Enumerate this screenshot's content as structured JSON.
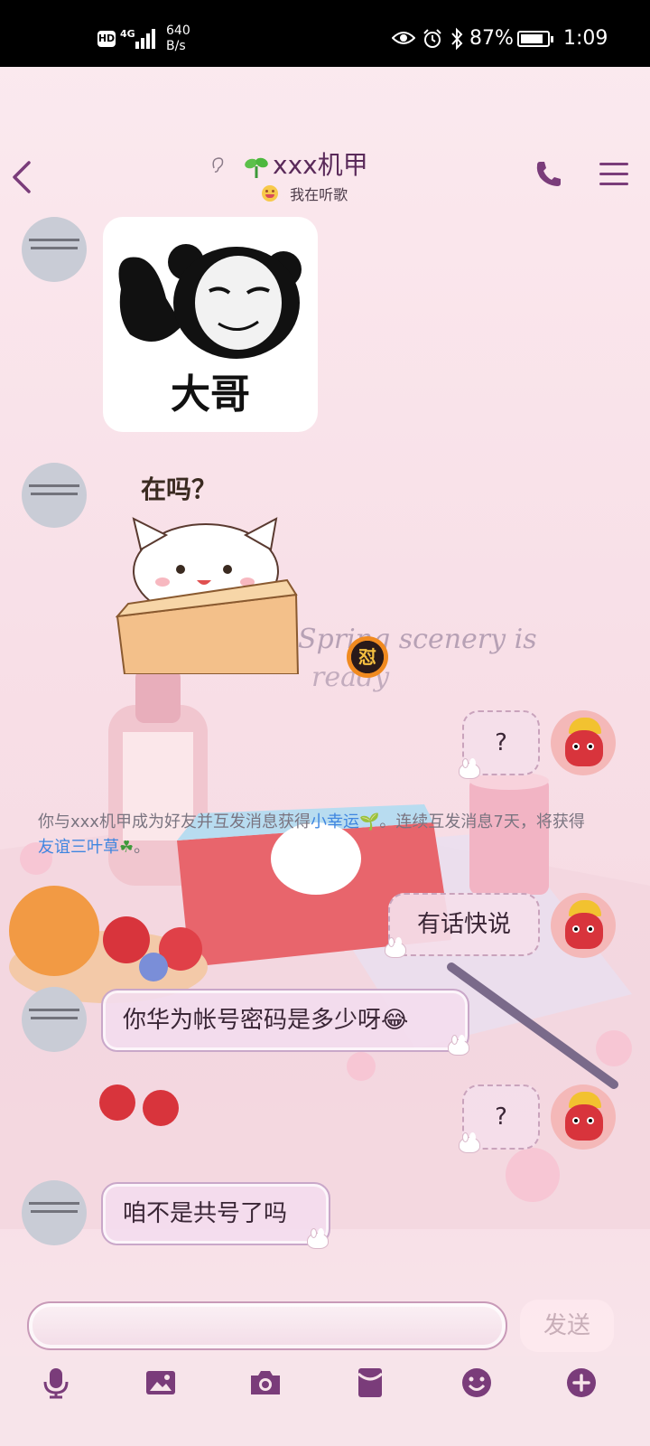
{
  "status_bar": {
    "hd": "HD",
    "network": "4G",
    "speed_value": "640",
    "speed_unit": "B/s",
    "battery_pct": "87%",
    "battery_level": 0.87,
    "time": "1:09"
  },
  "header": {
    "title": "xxx机甲",
    "subtitle": "我在听歌"
  },
  "messages": [
    {
      "side": "left",
      "type": "sticker",
      "sticker": "panda-meme",
      "caption": "大哥"
    },
    {
      "side": "left",
      "type": "sticker",
      "sticker": "cat-in-box",
      "caption": "在吗？"
    },
    {
      "side": "right",
      "type": "text",
      "text": "?"
    },
    {
      "side": "system",
      "type": "notice"
    },
    {
      "side": "right",
      "type": "text",
      "text": "有话快说"
    },
    {
      "side": "left",
      "type": "text",
      "text": "你华为帐号密码是多少呀😂"
    },
    {
      "side": "right",
      "type": "text",
      "text": "?"
    },
    {
      "side": "left",
      "type": "text",
      "text": "咱不是共号了吗"
    }
  ],
  "system_notice": {
    "part1": "你与xxx机甲成为好友并互发消息获得",
    "link1": "小幸运",
    "part2": "。连续互发消息7天，将获得",
    "link2": "友谊三叶草",
    "part3": "。"
  },
  "fire_badge": "怼",
  "background_text": {
    "line1": "Spring scenery is",
    "line2": "ready"
  },
  "input": {
    "value": "",
    "send_label": "发送"
  },
  "toolbar_icons": [
    "microphone-icon",
    "image-icon",
    "camera-icon",
    "red-packet-icon",
    "emoji-icon",
    "plus-icon"
  ],
  "colors": {
    "accent": "#7a3c7a",
    "link": "#3f86e0",
    "background": "#f8dfe7"
  }
}
